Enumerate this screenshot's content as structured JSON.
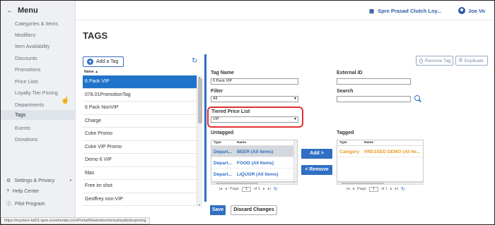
{
  "sidebar": {
    "title": "Menu",
    "items": [
      {
        "label": "Categories & Items"
      },
      {
        "label": "Modifiers"
      },
      {
        "label": "Item Availability"
      },
      {
        "label": "Discounts"
      },
      {
        "label": "Promotions"
      },
      {
        "label": "Price Lists"
      },
      {
        "label": "Loyalty Tier Pricing"
      },
      {
        "label": "Departments"
      },
      {
        "label": "Tags"
      },
      {
        "label": "Events"
      },
      {
        "label": "Donations"
      }
    ],
    "footer": [
      {
        "label": "Settings & Privacy"
      },
      {
        "label": "Help Center"
      },
      {
        "label": "Pilot Program"
      }
    ]
  },
  "header": {
    "store_name": "Spre Prasad Clutch Loy...",
    "user_name": "Joe Vo"
  },
  "page": {
    "title": "TAGS"
  },
  "tag_list": {
    "add_label": "Add a Tag",
    "column_header": "Name ▲",
    "items": [
      {
        "label": "6 Pack VIP"
      },
      {
        "label": "078.01PromotionTag"
      },
      {
        "label": "6 Pack NonVIP"
      },
      {
        "label": "Charge"
      },
      {
        "label": "Coke Promo"
      },
      {
        "label": "Coke VIP Promo"
      },
      {
        "label": "Demo 6 VIP"
      },
      {
        "label": "fdas"
      },
      {
        "label": "Free im shot"
      },
      {
        "label": "Geoffrey non-VIP"
      }
    ]
  },
  "actions": {
    "remove_tag": "Remove Tag",
    "duplicate": "Duplicate"
  },
  "form": {
    "tag_name_label": "Tag Name",
    "tag_name_value": "6 Pack VIP",
    "external_id_label": "External ID",
    "external_id_value": "",
    "filter_label": "Filter",
    "filter_value": "All",
    "search_label": "Search",
    "search_value": "",
    "tiered_label": "Tiered Price List",
    "tiered_value": "VIP"
  },
  "untagged": {
    "title": "Untagged",
    "col_type": "Type",
    "col_name": "Name",
    "rows": [
      {
        "type": "Depart...",
        "name": "BEER (All Items)"
      },
      {
        "type": "Depart...",
        "name": "FOOD (All Items)"
      },
      {
        "type": "Depart...",
        "name": "LIQUOR (All Items)"
      }
    ],
    "page_label": "Page",
    "page_value": "1",
    "of_label": "of 1"
  },
  "tagged": {
    "title": "Tagged",
    "col_type": "Type",
    "col_name": "Name",
    "rows": [
      {
        "type": "Category",
        "name": "PRESSED DEMO (All Ite..."
      }
    ],
    "page_label": "Page",
    "page_value": "1",
    "of_label": "of 1"
  },
  "buttons": {
    "add": "Add >",
    "remove": "< Remove",
    "save": "Save",
    "discard": "Discard Changes"
  },
  "status_bar": {
    "url": "https://mystore-tst01-spre.evosheriab.com/Portal/Newindex/menu/loyaltytierpricing"
  }
}
